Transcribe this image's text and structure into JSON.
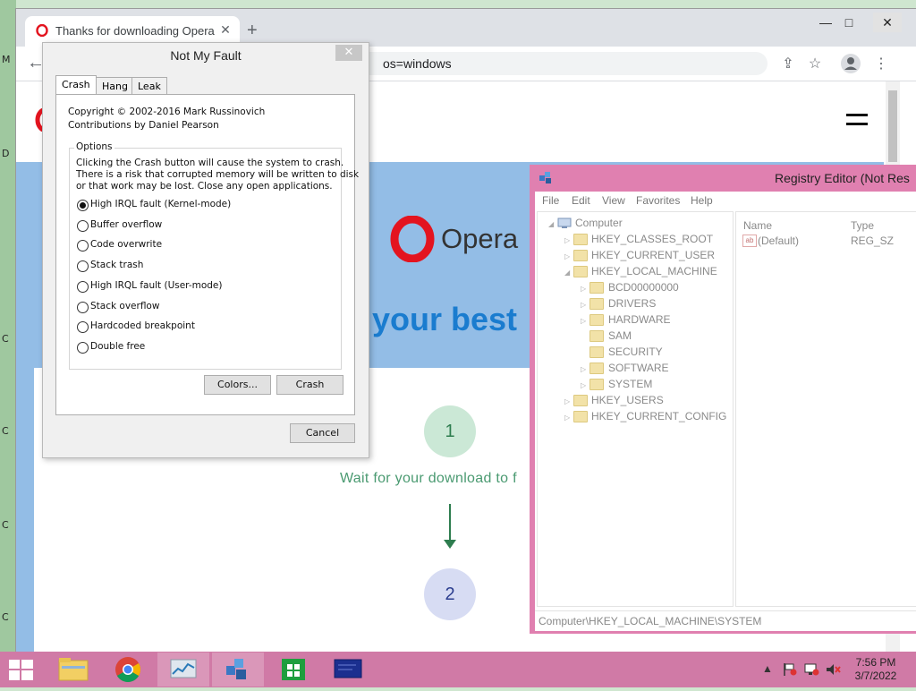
{
  "desktop": {
    "fragments": [
      "M",
      "D",
      "C",
      "C",
      "C",
      "C"
    ]
  },
  "browser": {
    "tab_title": "Thanks for downloading Opera",
    "tab_close": "✕",
    "new_tab": "+",
    "url_text": "os=windows",
    "back": "←",
    "min": "—",
    "max": "□",
    "close": "✕",
    "share_icon": "⇪",
    "star_icon": "☆",
    "menu_icon": "⋮",
    "page": {
      "brand": "Opera",
      "hero_text": "your best",
      "step1_number": "1",
      "step1_text": "Wait for your download to f",
      "step2_number": "2"
    }
  },
  "not_my_fault": {
    "title": "Not My Fault",
    "close": "✕",
    "tabs": [
      "Crash",
      "Hang",
      "Leak"
    ],
    "copyright": "Copyright © 2002-2016 Mark Russinovich",
    "contributions": "Contributions by Daniel Pearson",
    "options_label": "Options",
    "description": [
      "Clicking the Crash button will cause the system to crash.",
      "There is a risk that corrupted memory will be written to disk",
      "or that work may be lost. Close any open applications."
    ],
    "options": [
      {
        "label": "High IRQL fault (Kernel-mode)",
        "selected": true
      },
      {
        "label": "Buffer overflow",
        "selected": false
      },
      {
        "label": "Code overwrite",
        "selected": false
      },
      {
        "label": "Stack trash",
        "selected": false
      },
      {
        "label": "High IRQL fault (User-mode)",
        "selected": false
      },
      {
        "label": "Stack overflow",
        "selected": false
      },
      {
        "label": "Hardcoded breakpoint",
        "selected": false
      },
      {
        "label": "Double free",
        "selected": false
      }
    ],
    "colors_button": "Colors...",
    "crash_button": "Crash",
    "cancel_button": "Cancel"
  },
  "registry": {
    "title": "Registry Editor (Not Res",
    "menu": [
      "File",
      "Edit",
      "View",
      "Favorites",
      "Help"
    ],
    "tree": {
      "root": "Computer",
      "items": [
        {
          "label": "HKEY_CLASSES_ROOT",
          "level": 1
        },
        {
          "label": "HKEY_CURRENT_USER",
          "level": 1
        },
        {
          "label": "HKEY_LOCAL_MACHINE",
          "level": 1
        },
        {
          "label": "BCD00000000",
          "level": 2
        },
        {
          "label": "DRIVERS",
          "level": 2
        },
        {
          "label": "HARDWARE",
          "level": 2
        },
        {
          "label": "SAM",
          "level": 2
        },
        {
          "label": "SECURITY",
          "level": 2
        },
        {
          "label": "SOFTWARE",
          "level": 2
        },
        {
          "label": "SYSTEM",
          "level": 2
        },
        {
          "label": "HKEY_USERS",
          "level": 1
        },
        {
          "label": "HKEY_CURRENT_CONFIG",
          "level": 1
        }
      ]
    },
    "columns": [
      "Name",
      "Type"
    ],
    "values": [
      {
        "name": "(Default)",
        "type": "REG_SZ",
        "icon": "ab"
      }
    ],
    "status": "Computer\\HKEY_LOCAL_MACHINE\\SYSTEM"
  },
  "taskbar": {
    "time": "7:56 PM",
    "date": "3/7/2022",
    "apps": [
      "file-explorer",
      "chrome",
      "resource-monitor",
      "registry-editor",
      "store",
      "remote-desktop"
    ],
    "tray_arrow": "▲"
  }
}
